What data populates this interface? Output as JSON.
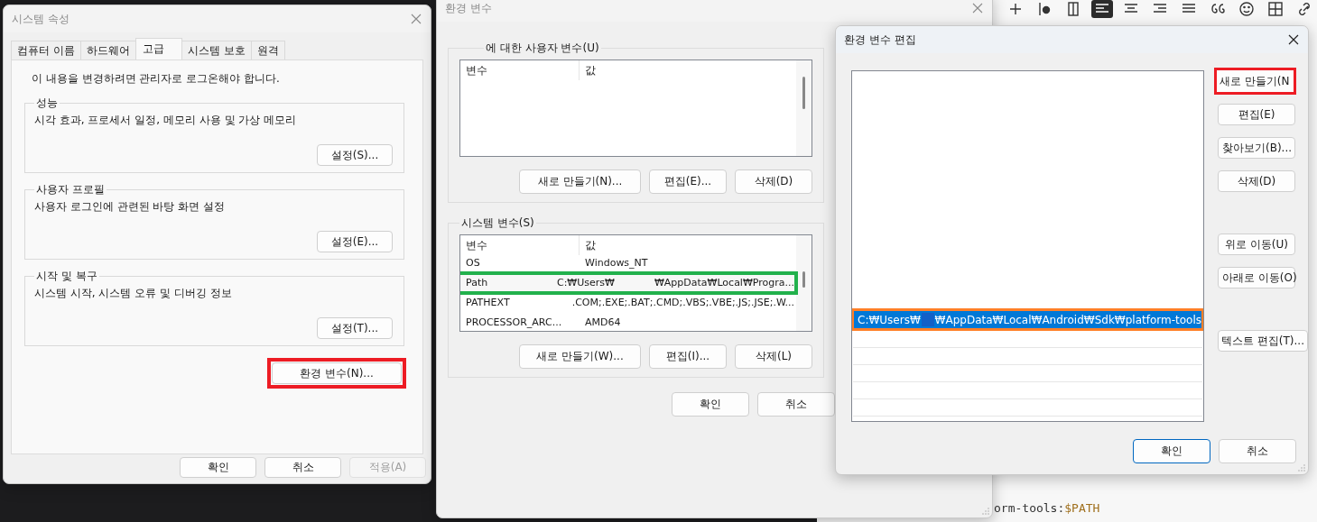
{
  "editor_toolbar": [
    {
      "kind": "plus",
      "selected": false
    },
    {
      "kind": "bullet",
      "selected": false
    },
    {
      "kind": "box",
      "selected": false
    },
    {
      "kind": "align-left",
      "selected": true
    },
    {
      "kind": "align-center",
      "selected": false
    },
    {
      "kind": "align-right",
      "selected": false
    },
    {
      "kind": "justify",
      "selected": false
    },
    {
      "kind": "quote",
      "selected": false
    },
    {
      "kind": "smiley",
      "selected": false
    },
    {
      "kind": "table",
      "selected": false
    },
    {
      "kind": "link",
      "selected": false
    }
  ],
  "code_line": [
    {
      "kind": "plain",
      "text": "orm-tools:"
    },
    {
      "kind": "variable",
      "text": "$PATH"
    }
  ],
  "system_properties": {
    "title": "시스템 속성",
    "tabs": [
      {
        "label": "컴퓨터 이름",
        "selected": false
      },
      {
        "label": "하드웨어",
        "selected": false
      },
      {
        "label": "고급",
        "selected": true
      },
      {
        "label": "시스템 보호",
        "selected": false
      },
      {
        "label": "원격",
        "selected": false
      }
    ],
    "notice": "이 내용을 변경하려면 관리자로 로그온해야 합니다.",
    "groups": [
      {
        "title": "성능",
        "description": "시각 효과, 프로세서 일정, 메모리 사용 및 가상 메모리",
        "button": "설정(S)..."
      },
      {
        "title": "사용자 프로필",
        "description": "사용자 로그인에 관련된 바탕 화면 설정",
        "button": "설정(E)..."
      },
      {
        "title": "시작 및 복구",
        "description": "시스템 시작, 시스템 오류 및 디버깅 정보",
        "button": "설정(T)..."
      }
    ],
    "env_button": {
      "label": "환경 변수(N)...",
      "color": "#ed1c24"
    },
    "buttons": [
      {
        "label": "확인",
        "disabled": false
      },
      {
        "label": "취소",
        "disabled": false
      },
      {
        "label": "적용(A)",
        "disabled": true
      }
    ]
  },
  "environment_variables": {
    "title": "환경 변수",
    "user_group": {
      "title": "에 대한 사용자 변수(U)",
      "columns": [
        "변수",
        "값"
      ],
      "buttons": [
        "새로 만들기(N)...",
        "편집(E)...",
        "삭제(D)"
      ]
    },
    "system_group": {
      "title": "시스템 변수(S)",
      "columns": [
        "변수",
        "값"
      ],
      "rows": [
        {
          "name": "OS",
          "value": [
            "Windows_NT"
          ]
        },
        {
          "name": "Path",
          "value": [
            "C:₩Users₩",
            "₩AppData₩Local₩Progra..."
          ],
          "color": "#22b14c"
        },
        {
          "name": "PATHEXT",
          "value": [
            ".COM;.EXE;.BAT;.CMD;.VBS;.VBE;.JS;.JSE;.W..."
          ]
        },
        {
          "name": "PROCESSOR_ARC...",
          "value": [
            "AMD64"
          ]
        }
      ],
      "buttons": [
        "새로 만들기(W)...",
        "편집(I)...",
        "삭제(L)"
      ]
    },
    "buttons": [
      "확인",
      "취소"
    ]
  },
  "edit_variable": {
    "title": "환경 변수 편집",
    "entries": [
      {
        "value": [
          "C:₩Users₩",
          "₩AppData₩Local₩Android₩Sdk₩platform-tools"
        ],
        "selected": true,
        "color": "#ff7f27"
      }
    ],
    "side_buttons": [
      {
        "label": "새로 만들기(N",
        "color": "#ed1c24"
      },
      {
        "label": "편집(E)"
      },
      {
        "label": "찾아보기(B)..."
      },
      {
        "label": "삭제(D)"
      },
      {
        "label": "위로 이동(U)"
      },
      {
        "label": "아래로 이동(O)"
      },
      {
        "label": "텍스트 편집(T)..."
      }
    ],
    "buttons": [
      {
        "label": "확인",
        "default": true
      },
      {
        "label": "취소",
        "default": false
      }
    ]
  }
}
